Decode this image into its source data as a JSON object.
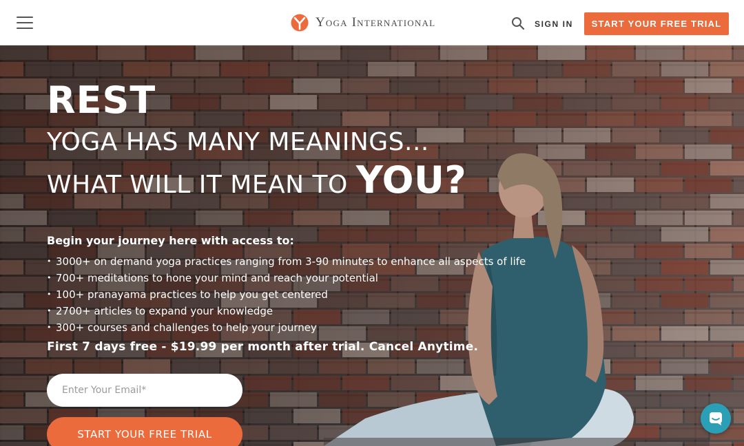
{
  "header": {
    "brand": "Yoga International",
    "sign_in_label": "SIGN IN",
    "cta_label": "START YOUR FREE TRIAL"
  },
  "hero": {
    "title": "REST",
    "line1": "YOGA HAS MANY MEANINGS...",
    "line2_prefix": "WHAT WILL IT MEAN TO",
    "line2_emphasis": "YOU?",
    "intro": "Begin your journey here with access to:",
    "features": [
      "3000+ on demand yoga practices ranging from 3-90 minutes to enhance all aspects of life",
      "700+ meditations to hone your mind and reach your potential",
      "100+ pranayama practices to help you get centered",
      "2700+ articles to expand your knowledge",
      "300+ courses and challenges to help your journey"
    ],
    "offer": "First 7 days free - $19.99 per month after trial. Cancel Anytime.",
    "email_placeholder": "Enter Your Email*",
    "cta_label": "START YOUR FREE TRIAL"
  },
  "icons": {
    "menu": "hamburger-menu-icon",
    "logo": "yoga-international-logo-icon",
    "search": "search-icon",
    "chat": "chat-icon"
  },
  "colors": {
    "accent": "#ec6b3d",
    "chat": "#2a9fb5"
  }
}
